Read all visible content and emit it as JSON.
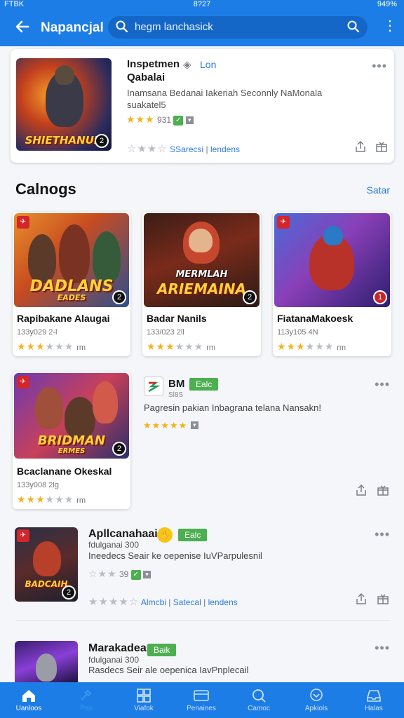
{
  "status_bar": {
    "carrier": "FTBK",
    "time": "8?27",
    "battery": "949%"
  },
  "header": {
    "title": "Napancjal",
    "search_text": "hegm lanchasick"
  },
  "featured": {
    "title": "Inspetmen",
    "sub_title": "Qabalai",
    "link": "Lon",
    "description": "Inamsana Bedanai Iakeriah Seconnly NaMonala suakatel5",
    "rating_text": "931",
    "art_text": "SHIETHANUN",
    "footer_text": "SSarecsi",
    "footer_link": "lendens"
  },
  "section": {
    "title": "Calnogs",
    "link": "Satar"
  },
  "grid": [
    {
      "name": "Rapibakane Alaugai",
      "meta": "133y029",
      "meta2": "2-l",
      "tail": "rm",
      "art_text": "DADLANS",
      "art_sub": "EADES",
      "stars": 3
    },
    {
      "name": "Badar Nanils",
      "meta": "133/023",
      "meta2": "2ll",
      "tail": "rm",
      "art_text": "ARIEMAINA",
      "art_sub": "MERMLAH",
      "stars": 3
    },
    {
      "name": "FiatanaMakoesk",
      "meta": "113y105",
      "meta2": "4N",
      "tail": "rm",
      "art_text": "",
      "art_sub": "",
      "stars": 3
    }
  ],
  "wide_item": {
    "name": "Bcaclanane Okeskal",
    "meta": "133y008",
    "meta2": "2lg",
    "tail": "rm",
    "art_text": "BRIDMAN",
    "art_sub": "ERMES",
    "app_name": "BM",
    "app_sub": "Sl8S",
    "tag": "Ealc",
    "description": "Pagresin pakian Inbagrana telana Nansakn!"
  },
  "list_items": [
    {
      "title": "Apllcanahaai",
      "tag": "Ealc",
      "sub": "fdulganai 300",
      "description": "Ineedecs Seair ke oepenise IuVParpulesnil",
      "rating_text": "39",
      "footer_text": "Almcbi",
      "footer_text2": "Satecal",
      "footer_link": "lendens",
      "art_text": "BADCAIH"
    },
    {
      "title": "Marakadeas",
      "tag": "Baik",
      "sub": "fdulganai 300",
      "description": "Rasdecs Seir ale oepenica IavPnplecail"
    }
  ],
  "bottom_nav": [
    {
      "label": "Uanloos",
      "icon": "home-icon"
    },
    {
      "label": "Pas",
      "icon": "tools-icon"
    },
    {
      "label": "Viafok",
      "icon": "grid-icon"
    },
    {
      "label": "Penaines",
      "icon": "card-icon"
    },
    {
      "label": "Camoc",
      "icon": "search-icon"
    },
    {
      "label": "Apkiols",
      "icon": "badge-icon"
    },
    {
      "label": "Halas",
      "icon": "inbox-icon"
    }
  ],
  "colors": {
    "primary": "#1d7de6",
    "accent_green": "#4caf50",
    "star": "#f2b21c"
  }
}
